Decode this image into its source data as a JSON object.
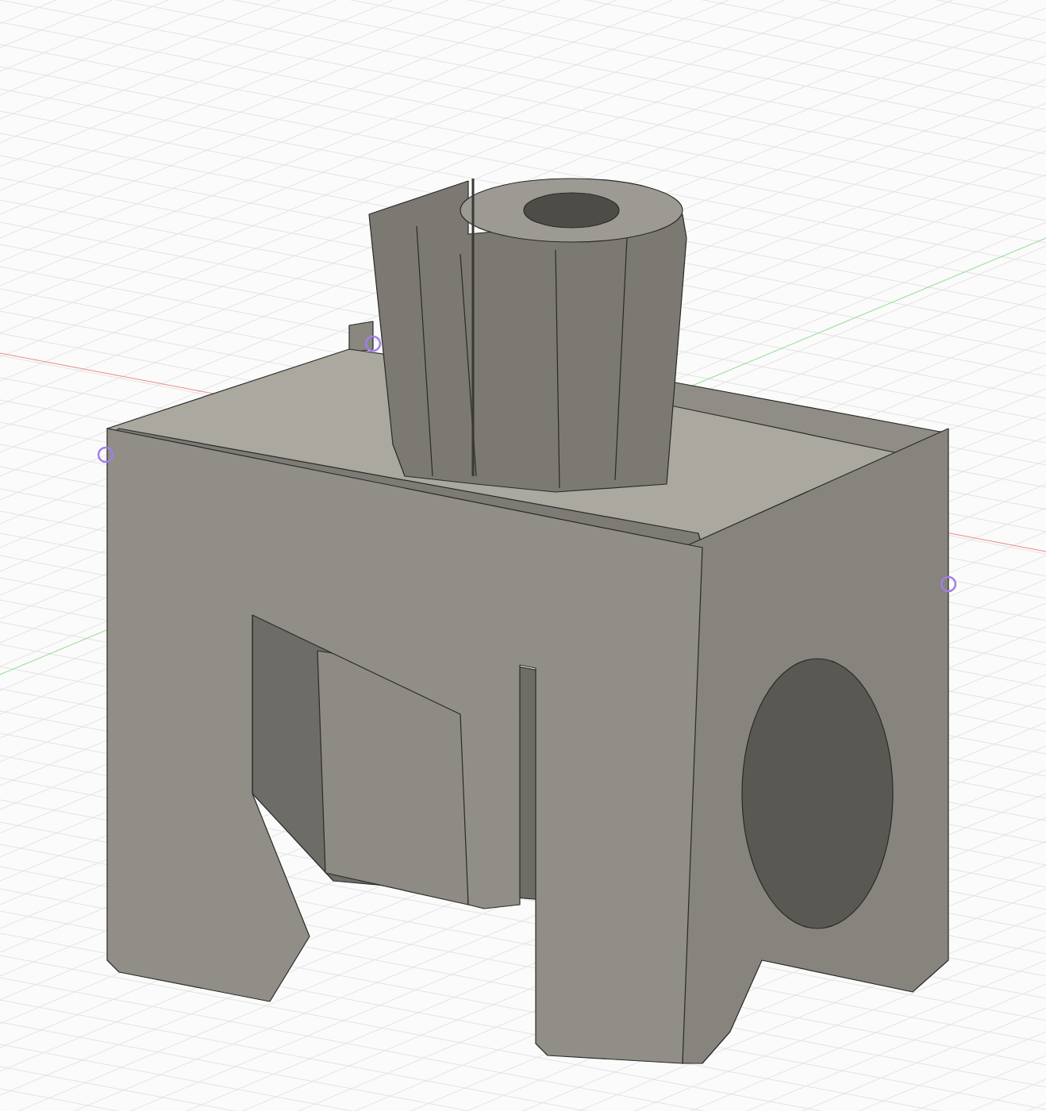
{
  "viewport": {
    "grid_visible": true,
    "axes_visible": true,
    "point_markers_visible": true
  }
}
